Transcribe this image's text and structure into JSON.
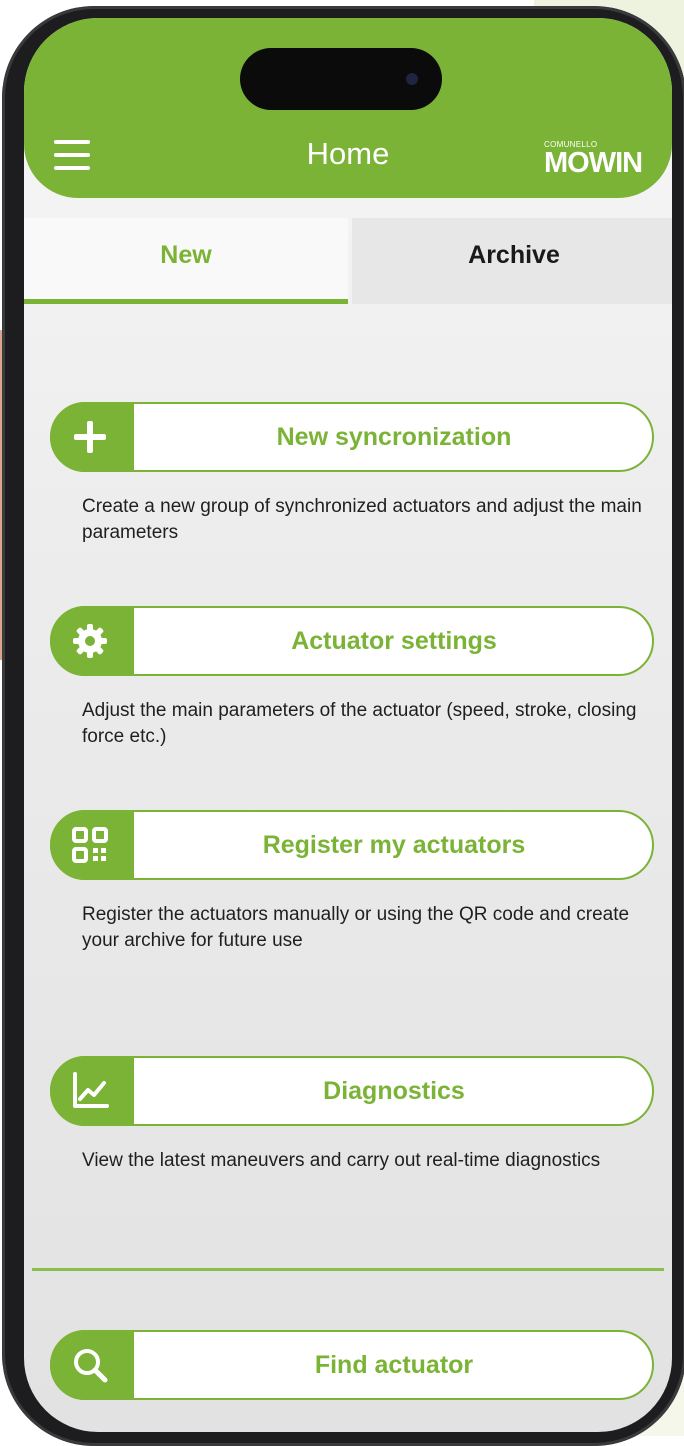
{
  "header": {
    "title": "Home",
    "logo_top": "COMUNELLO",
    "logo_main": "MOWIN"
  },
  "tabs": [
    {
      "label": "New",
      "active": true
    },
    {
      "label": "Archive",
      "active": false
    }
  ],
  "actions": [
    {
      "icon": "plus-icon",
      "label": "New syncronization",
      "description": "Create a new group of synchronized actuators and adjust the main parameters"
    },
    {
      "icon": "gear-icon",
      "label": "Actuator settings",
      "description": "Adjust the main parameters of the actuator (speed, stroke, closing force etc.)"
    },
    {
      "icon": "qr-code-icon",
      "label": "Register my actuators",
      "description": "Register the actuators manually or using the QR code and create your archive for future use"
    },
    {
      "icon": "chart-line-icon",
      "label": "Diagnostics",
      "description": "View the latest maneuvers and carry out real-time diagnostics"
    }
  ],
  "footer_action": {
    "icon": "search-icon",
    "label": "Find actuator"
  },
  "colors": {
    "accent": "#7ab335",
    "text": "#1f1f1f",
    "tab_inactive_bg": "#e7e7e7"
  }
}
